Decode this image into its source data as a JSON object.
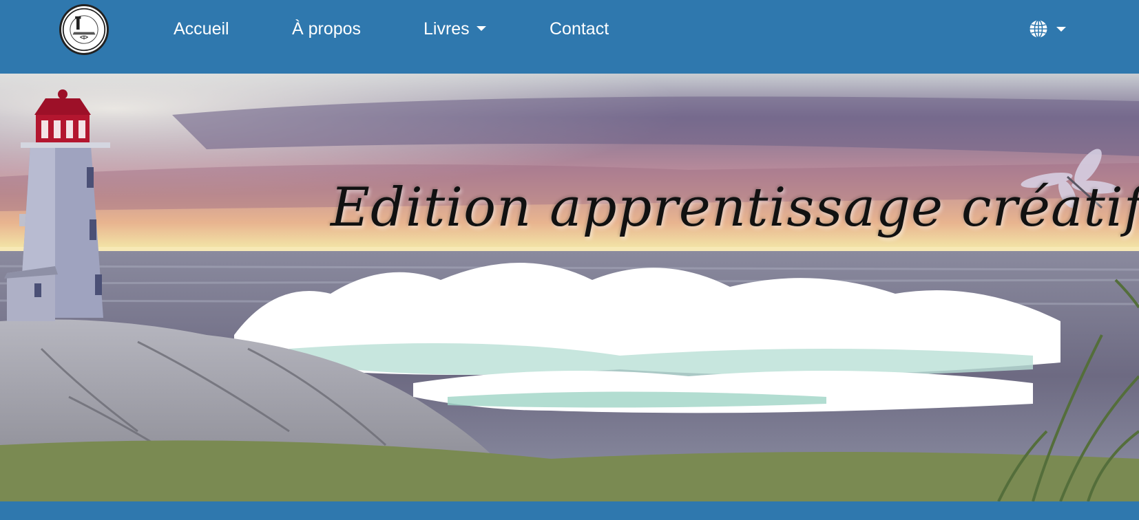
{
  "site": {
    "logo_alt": "Edition apprentissage créatif logo"
  },
  "nav": {
    "home": "Accueil",
    "about": "À propos",
    "books": "Livres",
    "contact": "Contact",
    "language_icon": "globe-icon"
  },
  "hero": {
    "title": "Edition apprentissage créatif"
  },
  "colors": {
    "navbar": "#2f78ae",
    "text": "#ffffff"
  }
}
